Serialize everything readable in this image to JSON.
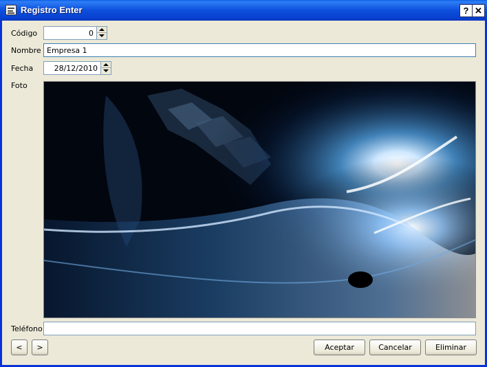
{
  "window": {
    "title": "Registro Enter",
    "help_label": "?",
    "close_label": "✕",
    "icon": "form-icon"
  },
  "form": {
    "codigo_label": "Código",
    "codigo_value": "0",
    "nombre_label": "Nombre",
    "nombre_value": "Empresa 1",
    "fecha_label": "Fecha",
    "fecha_value": "28/12/2010",
    "foto_label": "Foto",
    "telefono_label": "Teléfono",
    "telefono_value": ""
  },
  "buttons": {
    "prev_label": "<",
    "next_label": ">",
    "aceptar_label": "Aceptar",
    "cancelar_label": "Cancelar",
    "eliminar_label": "Eliminar"
  }
}
